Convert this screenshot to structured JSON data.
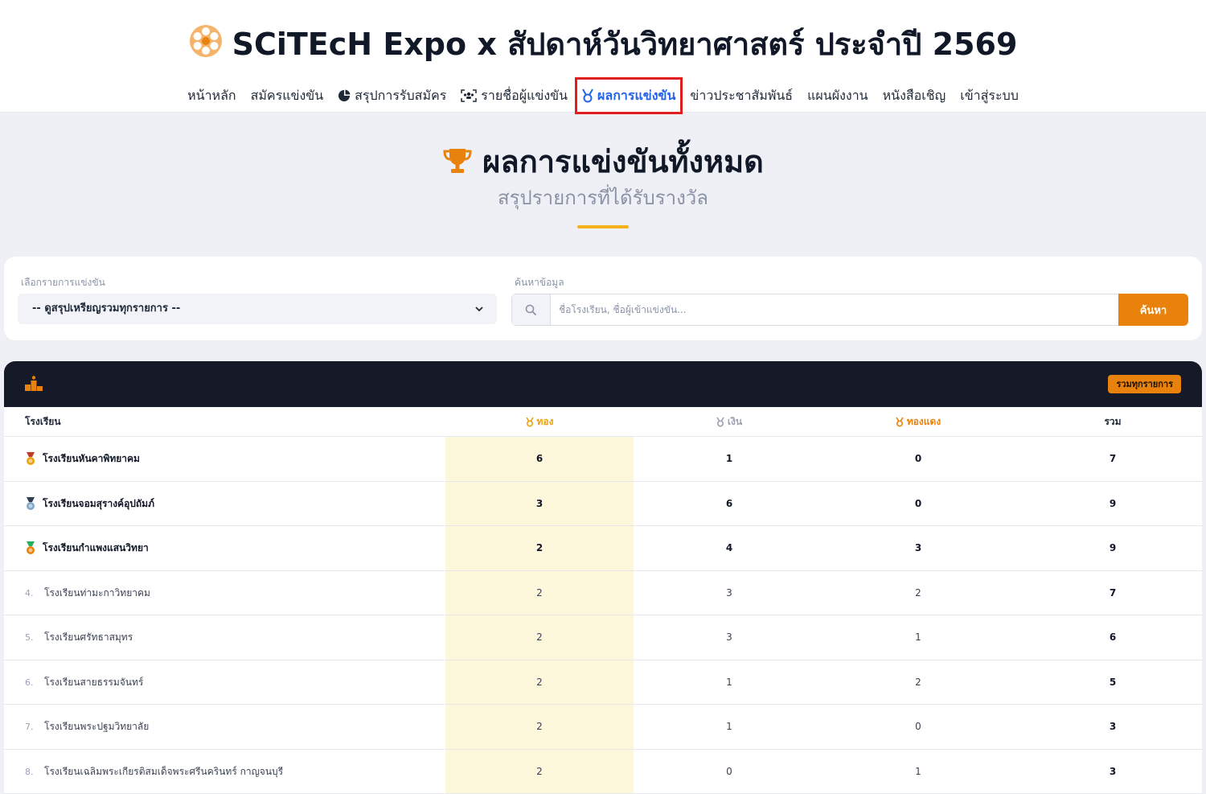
{
  "site": {
    "title": "SCiTEcH Expo x สัปดาห์วันวิทยาศาสตร์ ประจำปี 2569"
  },
  "nav": {
    "items": [
      {
        "label": "หน้าหลัก",
        "icon": ""
      },
      {
        "label": "สมัครแข่งขัน",
        "icon": ""
      },
      {
        "label": "สรุปการรับสมัคร",
        "icon": "pie-chart-icon"
      },
      {
        "label": "รายชื่อผู้แข่งขัน",
        "icon": "users-icon"
      },
      {
        "label": "ผลการแข่งขัน",
        "icon": "medal-icon",
        "active": true
      },
      {
        "label": "ข่าวประชาสัมพันธ์",
        "icon": ""
      },
      {
        "label": "แผนผังงาน",
        "icon": ""
      },
      {
        "label": "หนังสือเชิญ",
        "icon": ""
      },
      {
        "label": "เข้าสู่ระบบ",
        "icon": ""
      }
    ]
  },
  "hero": {
    "title": "ผลการแข่งขันทั้งหมด",
    "subtitle": "สรุปรายการที่ได้รับรางวัล",
    "icon": "trophy-icon"
  },
  "filters": {
    "select_label": "เลือกรายการแข่งขัน",
    "select_value": "-- ดูสรุปเหรียญรวมทุกรายการ --",
    "search_label": "ค้นหาข้อมูล",
    "search_placeholder": "ชื่อโรงเรียน, ชื่อผู้เข้าแข่งขัน...",
    "search_value": "",
    "search_button": "ค้นหา"
  },
  "table": {
    "badge": "รวมทุกรายการ",
    "columns": {
      "school": "โรงเรียน",
      "gold": "ทอง",
      "silver": "เงิน",
      "bronze": "ทองแดง",
      "total": "รวม"
    },
    "colors": {
      "gold": "#e9a20c",
      "silver": "#9aa1b1",
      "bronze": "#e9820c",
      "accent": "#e9820c",
      "dark_header": "#161a28",
      "gold_column_bg": "#fdf7dc"
    },
    "rows": [
      {
        "rank": "",
        "medal": "gold",
        "school": "โรงเรียนหันคาพิทยาคม",
        "gold": "6",
        "silver": "1",
        "bronze": "0",
        "total": "7"
      },
      {
        "rank": "",
        "medal": "silver",
        "school": "โรงเรียนจอมสุรางค์อุปถัมภ์",
        "gold": "3",
        "silver": "6",
        "bronze": "0",
        "total": "9"
      },
      {
        "rank": "",
        "medal": "bronze",
        "school": "โรงเรียนกำแพงแสนวิทยา",
        "gold": "2",
        "silver": "4",
        "bronze": "3",
        "total": "9"
      },
      {
        "rank": "4.",
        "medal": "",
        "school": "โรงเรียนท่ามะกาวิทยาคม",
        "gold": "2",
        "silver": "3",
        "bronze": "2",
        "total": "7"
      },
      {
        "rank": "5.",
        "medal": "",
        "school": "โรงเรียนศรัทธาสมุทร",
        "gold": "2",
        "silver": "3",
        "bronze": "1",
        "total": "6"
      },
      {
        "rank": "6.",
        "medal": "",
        "school": "โรงเรียนสายธรรมจันทร์",
        "gold": "2",
        "silver": "1",
        "bronze": "2",
        "total": "5"
      },
      {
        "rank": "7.",
        "medal": "",
        "school": "โรงเรียนพระปฐมวิทยาลัย",
        "gold": "2",
        "silver": "1",
        "bronze": "0",
        "total": "3"
      },
      {
        "rank": "8.",
        "medal": "",
        "school": "โรงเรียนเฉลิมพระเกียรติสมเด็จพระศรีนครินทร์ กาญจนบุรี",
        "gold": "2",
        "silver": "0",
        "bronze": "1",
        "total": "3"
      }
    ]
  }
}
